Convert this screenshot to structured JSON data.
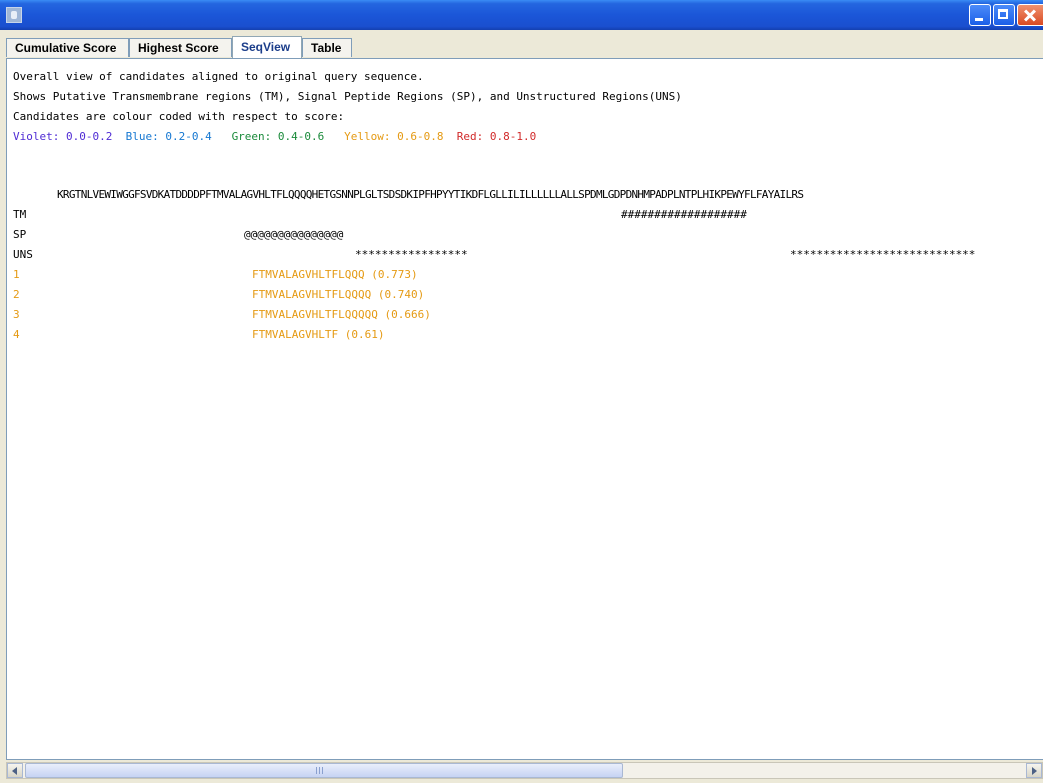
{
  "window": {
    "title": ""
  },
  "tabs": [
    {
      "label": "Cumulative Score"
    },
    {
      "label": "Highest Score"
    },
    {
      "label": "SeqView"
    },
    {
      "label": "Table"
    }
  ],
  "active_tab": "SeqView",
  "seqview": {
    "intro_lines": [
      "Overall view of candidates aligned to original query sequence.",
      "Shows Putative Transmembrane regions (TM), Signal Peptide Regions (SP), and Unstructured Regions(UNS)",
      "Candidates are colour coded with respect to score:"
    ],
    "legend": [
      {
        "text": "Violet: 0.0-0.2",
        "color": "#4f2bd4"
      },
      {
        "text": "Blue: 0.2-0.4",
        "color": "#1577d1"
      },
      {
        "text": "Green: 0.4-0.6",
        "color": "#1a8a3a"
      },
      {
        "text": "Yellow: 0.6-0.8",
        "color": "#e59a13"
      },
      {
        "text": "Red: 0.8-1.0",
        "color": "#d12a2a"
      }
    ],
    "query_sequence": "KRGTNLVEWIWGGFSVDKATDDDDPFTMVALAGVHLTFLQQQQHETGSNNPLGLTSDSDKIPFHPYYTIKDFLGLLILILLLLLLALLSPDMLGDPDNHMPADPLNTPLHIKPEWYFLFAYAILRS",
    "tracks": [
      {
        "label": "TM",
        "marks": "###################"
      },
      {
        "label": "SP",
        "marks": "@@@@@@@@@@@@@@@"
      },
      {
        "label": "UNS",
        "marks_1": "*****************",
        "marks_2": "****************************"
      }
    ],
    "candidates": [
      {
        "rank": "1",
        "sequence": "FTMVALAGVHLTFLQQQ",
        "score": "(0.773)"
      },
      {
        "rank": "2",
        "sequence": "FTMVALAGVHLTFLQQQQ",
        "score": "(0.740)"
      },
      {
        "rank": "3",
        "sequence": "FTMVALAGVHLTFLQQQQQ",
        "score": "(0.666)"
      },
      {
        "rank": "4",
        "sequence": "FTMVALAGVHLTF",
        "score": "(0.61)"
      }
    ],
    "candidate_color": "#e59a13"
  },
  "colors": {
    "titlebar": "#2466e0",
    "panel_bg": "#ffffff",
    "window_bg": "#ece9d8"
  }
}
